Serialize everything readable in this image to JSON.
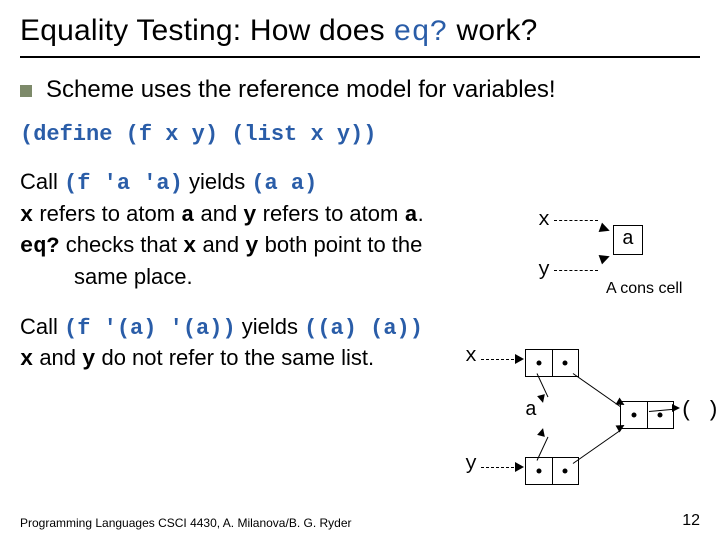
{
  "title_prefix": "Equality Testing: How does ",
  "title_eq": "eq?",
  "title_suffix": " work?",
  "bullet1": "Scheme uses the reference model for variables!",
  "define_code": "(define (f x y)  (list x y))",
  "call1": {
    "prefix": "Call ",
    "code1": "(f 'a 'a)",
    "mid1": " yields ",
    "code2": "(a a)",
    "line2a": "x",
    "line2b": " refers to atom ",
    "line2c": "a",
    "line2d": " and ",
    "line2e": "y",
    "line2f": " refers to atom ",
    "line2g": "a",
    "line2h": ".",
    "line3a": "eq?",
    "line3b": " checks that ",
    "line3c": "x",
    "line3d": " and ",
    "line3e": "y",
    "line3f": " both point to the",
    "line4": "same place."
  },
  "call2": {
    "prefix": "Call ",
    "code1": "(f '(a) '(a))",
    "mid1": " yields ",
    "code2": "((a)  (a))",
    "line2a": "x",
    "line2b": " and ",
    "line2c": "y",
    "line2d": " do not refer to the same list."
  },
  "diagram1": {
    "x": "x",
    "y": "y",
    "atom": "a",
    "caption": "A cons cell"
  },
  "diagram2": {
    "x": "x",
    "y": "y",
    "a": "a",
    "paren": "( )"
  },
  "footer": "Programming Languages CSCI 4430, A. Milanova/B. G. Ryder",
  "pagenum": "12"
}
